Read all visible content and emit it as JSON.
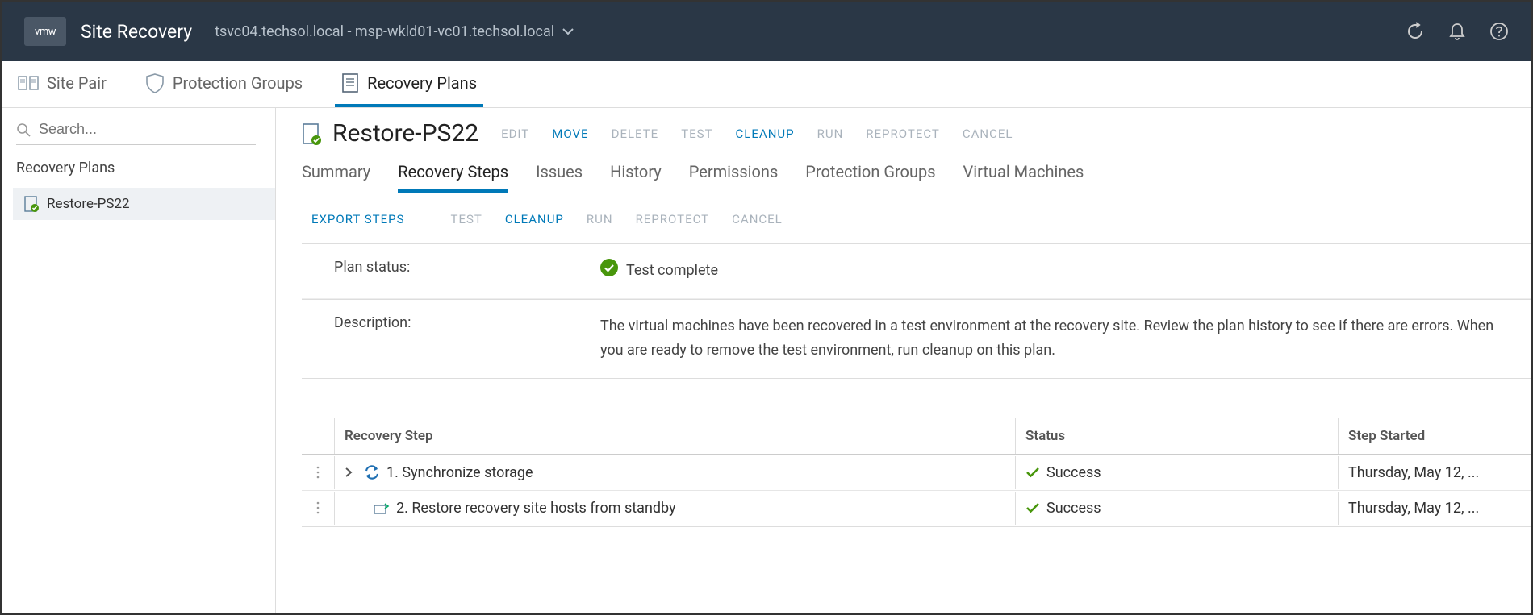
{
  "header": {
    "logo": "vmw",
    "title": "Site Recovery",
    "context": "tsvc04.techsol.local - msp-wkld01-vc01.techsol.local"
  },
  "nav": {
    "site_pair": "Site Pair",
    "protection_groups": "Protection Groups",
    "recovery_plans": "Recovery Plans"
  },
  "sidebar": {
    "search_placeholder": "Search...",
    "heading": "Recovery Plans",
    "items": [
      {
        "label": "Restore-PS22"
      }
    ]
  },
  "page": {
    "title": "Restore-PS22",
    "actions": {
      "edit": "EDIT",
      "move": "MOVE",
      "delete": "DELETE",
      "test": "TEST",
      "cleanup": "CLEANUP",
      "run": "RUN",
      "reprotect": "REPROTECT",
      "cancel": "CANCEL"
    },
    "tabs": {
      "summary": "Summary",
      "recovery_steps": "Recovery Steps",
      "issues": "Issues",
      "history": "History",
      "permissions": "Permissions",
      "protection_groups": "Protection Groups",
      "virtual_machines": "Virtual Machines"
    },
    "subactions": {
      "export_steps": "EXPORT STEPS",
      "test": "TEST",
      "cleanup": "CLEANUP",
      "run": "RUN",
      "reprotect": "REPROTECT",
      "cancel": "CANCEL"
    },
    "info": {
      "status_label": "Plan status:",
      "status_value": "Test complete",
      "description_label": "Description:",
      "description_value": "The virtual machines have been recovered in a test environment at the recovery site. Review the plan history to see if there are errors. When you are ready to remove the test environment, run cleanup on this plan."
    },
    "steps": {
      "columns": {
        "step": "Recovery Step",
        "status": "Status",
        "started": "Step Started"
      },
      "rows": [
        {
          "label": "1. Synchronize storage",
          "status": "Success",
          "started": "Thursday, May 12, ...",
          "expandable": true,
          "indent": 0
        },
        {
          "label": "2. Restore recovery site hosts from standby",
          "status": "Success",
          "started": "Thursday, May 12, ...",
          "expandable": false,
          "indent": 1
        }
      ]
    }
  },
  "colors": {
    "primary": "#0079b8",
    "success": "#48960c"
  }
}
